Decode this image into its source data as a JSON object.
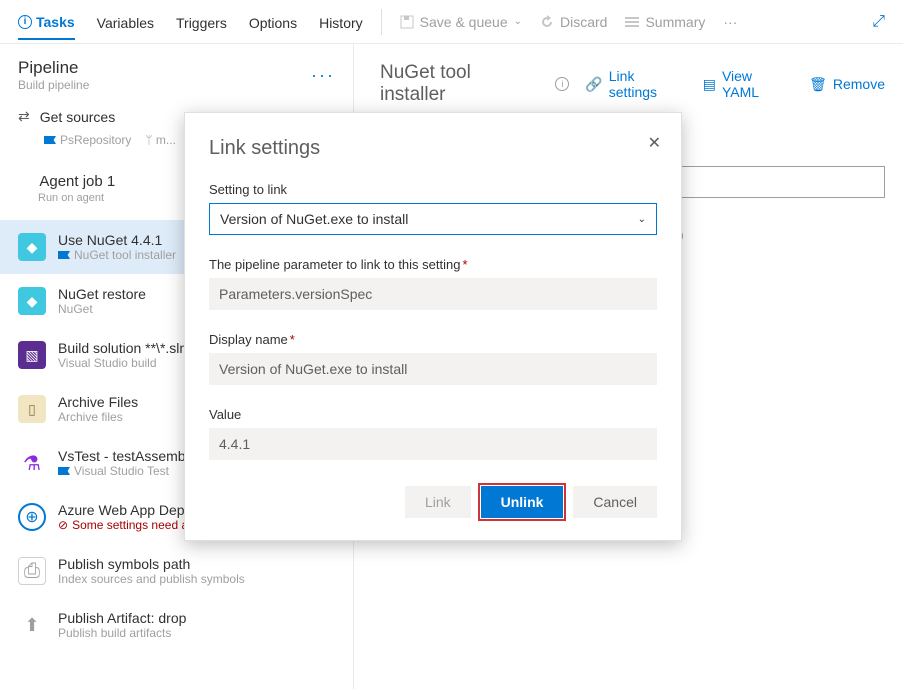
{
  "tabs": {
    "tasks": "Tasks",
    "variables": "Variables",
    "triggers": "Triggers",
    "options": "Options",
    "history": "History"
  },
  "topbar": {
    "save": "Save & queue",
    "discard": "Discard",
    "summary": "Summary"
  },
  "leftHeader": {
    "title": "Pipeline",
    "subtitle": "Build pipeline"
  },
  "sources": {
    "title": "Get sources",
    "repo": "PsRepository",
    "branch": "m..."
  },
  "agentJob": {
    "title": "Agent job 1",
    "subtitle": "Run on agent"
  },
  "tasksList": [
    {
      "title": "Use NuGet 4.4.1",
      "sub": "NuGet tool installer"
    },
    {
      "title": "NuGet restore",
      "sub": "NuGet"
    },
    {
      "title": "Build solution **\\*.sln",
      "sub": "Visual Studio build"
    },
    {
      "title": "Archive Files",
      "sub": "Archive files"
    },
    {
      "title": "VsTest - testAssemblies",
      "sub": "Visual Studio Test"
    },
    {
      "title": "Azure Web App Deploy: ...",
      "warn": "Some settings need attention"
    },
    {
      "title": "Publish symbols path",
      "sub": "Index sources and publish symbols"
    },
    {
      "title": "Publish Artifact: drop",
      "sub": "Publish build artifacts"
    }
  ],
  "right": {
    "title": "NuGet tool installer",
    "links": {
      "link": "Link settings",
      "yaml": "View YAML",
      "remove": "Remove"
    },
    "inlineInfo": "n"
  },
  "modal": {
    "title": "Link settings",
    "labels": {
      "setting": "Setting to link",
      "param": "The pipeline parameter to link to this setting",
      "display": "Display name",
      "value": "Value"
    },
    "settingSelected": "Version of NuGet.exe to install",
    "paramValue": "Parameters.versionSpec",
    "displayValue": "Version of NuGet.exe to install",
    "valueValue": "4.4.1",
    "buttons": {
      "link": "Link",
      "unlink": "Unlink",
      "cancel": "Cancel"
    }
  }
}
